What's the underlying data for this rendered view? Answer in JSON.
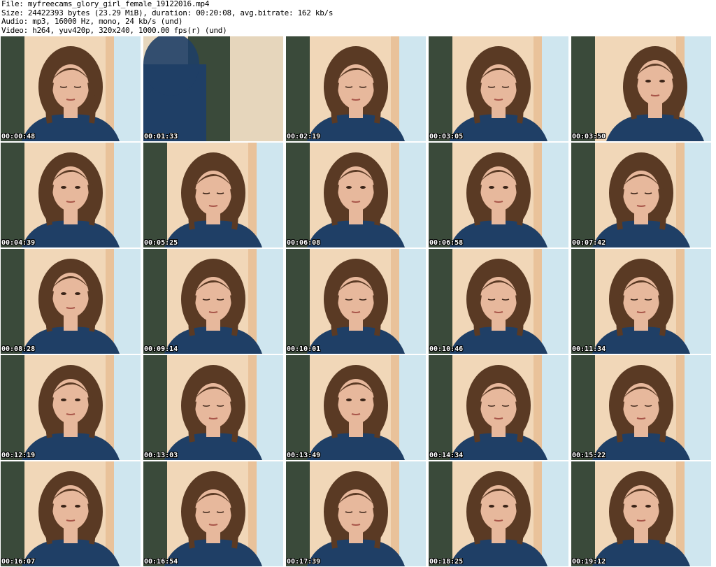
{
  "header": {
    "file_line": "File: myfreecams_glory_girl_female_19122016.mp4",
    "size_line": "Size: 24422393 bytes (23.29 MiB), duration: 00:20:08, avg.bitrate: 162 kb/s",
    "audio_line": "Audio: mp3, 16000 Hz, mono, 24 kb/s (und)",
    "video_line": "Video: h264, yuv420p, 320x240, 1000.00 fps(r) (und)"
  },
  "colors": {
    "shirt": "#1f3f66",
    "hair": "#5a3a24",
    "skin": "#e7b89c",
    "curtain": "#3a4a3a",
    "wall": "#f1d7b8",
    "window": "#cfe6ef"
  },
  "frames": [
    {
      "timestamp": "00:00:48",
      "scene": "head-down"
    },
    {
      "timestamp": "00:01:33",
      "scene": "moving-blur"
    },
    {
      "timestamp": "00:02:19",
      "scene": "head-down"
    },
    {
      "timestamp": "00:03:05",
      "scene": "head-down"
    },
    {
      "timestamp": "00:03:50",
      "scene": "head-tilt"
    },
    {
      "timestamp": "00:04:39",
      "scene": "face"
    },
    {
      "timestamp": "00:05:25",
      "scene": "head-down"
    },
    {
      "timestamp": "00:06:08",
      "scene": "face"
    },
    {
      "timestamp": "00:06:58",
      "scene": "face"
    },
    {
      "timestamp": "00:07:42",
      "scene": "head-down"
    },
    {
      "timestamp": "00:08:28",
      "scene": "face"
    },
    {
      "timestamp": "00:09:14",
      "scene": "head-down"
    },
    {
      "timestamp": "00:10:01",
      "scene": "head-down"
    },
    {
      "timestamp": "00:10:46",
      "scene": "head-down"
    },
    {
      "timestamp": "00:11:34",
      "scene": "head-down"
    },
    {
      "timestamp": "00:12:19",
      "scene": "face"
    },
    {
      "timestamp": "00:13:03",
      "scene": "head-down"
    },
    {
      "timestamp": "00:13:49",
      "scene": "face"
    },
    {
      "timestamp": "00:14:34",
      "scene": "head-down"
    },
    {
      "timestamp": "00:15:22",
      "scene": "head-down"
    },
    {
      "timestamp": "00:16:07",
      "scene": "face"
    },
    {
      "timestamp": "00:16:54",
      "scene": "head-down"
    },
    {
      "timestamp": "00:17:39",
      "scene": "head-down"
    },
    {
      "timestamp": "00:18:25",
      "scene": "face"
    },
    {
      "timestamp": "00:19:12",
      "scene": "face"
    }
  ]
}
